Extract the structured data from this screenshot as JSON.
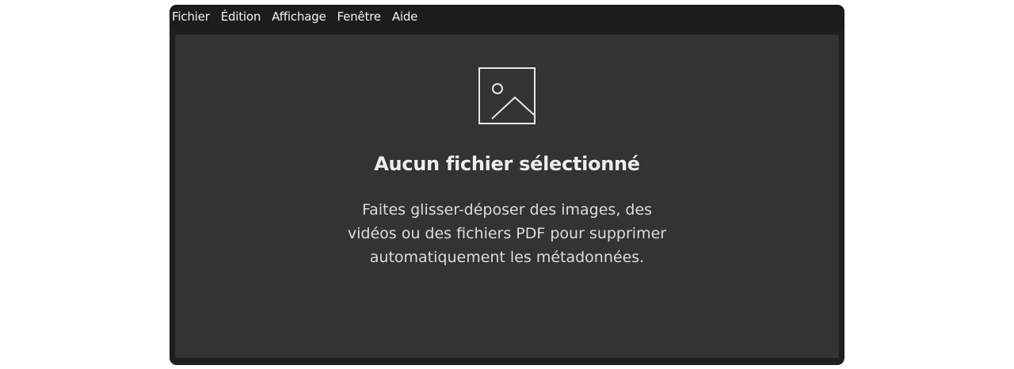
{
  "menubar": {
    "items": [
      {
        "label": "Fichier"
      },
      {
        "label": "Édition"
      },
      {
        "label": "Affichage"
      },
      {
        "label": "Fenêtre"
      },
      {
        "label": "Aide"
      }
    ]
  },
  "empty_state": {
    "icon": "image-icon",
    "title": "Aucun fichier sélectionné",
    "description": "Faites glisser-déposer des images, des vidéos ou des fichiers PDF pour supprimer automatiquement les métadonnées."
  },
  "colors": {
    "window_background": "#1f1f1f",
    "content_background": "#333333",
    "text_primary": "#ededed"
  }
}
